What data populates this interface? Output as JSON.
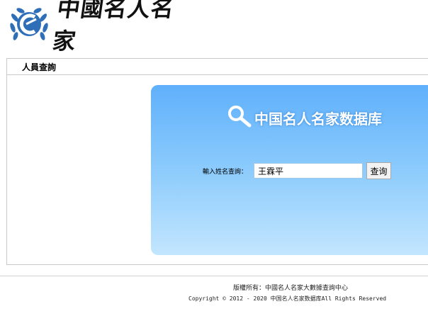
{
  "header": {
    "logo_text": "中國名人名家"
  },
  "main": {
    "tab_title": "人員查詢",
    "panel_title": "中国名人名家数据库",
    "query_label": "輸入姓名查詢：",
    "query_value": "王霖平",
    "query_button": "查询"
  },
  "footer": {
    "copyright_line": "版權所有：中國名人名家大數據查詢中心",
    "rights_line": "Copyright © 2012 - 2020 中国名人名家数据库All Rights Reserved"
  },
  "colors": {
    "panel_top": "#5fb0fb",
    "panel_bottom": "#c3e6fe",
    "logo_blue": "#2f6fb8"
  },
  "icons": [
    "logo-emblem-icon",
    "search-magnifier-icon"
  ]
}
